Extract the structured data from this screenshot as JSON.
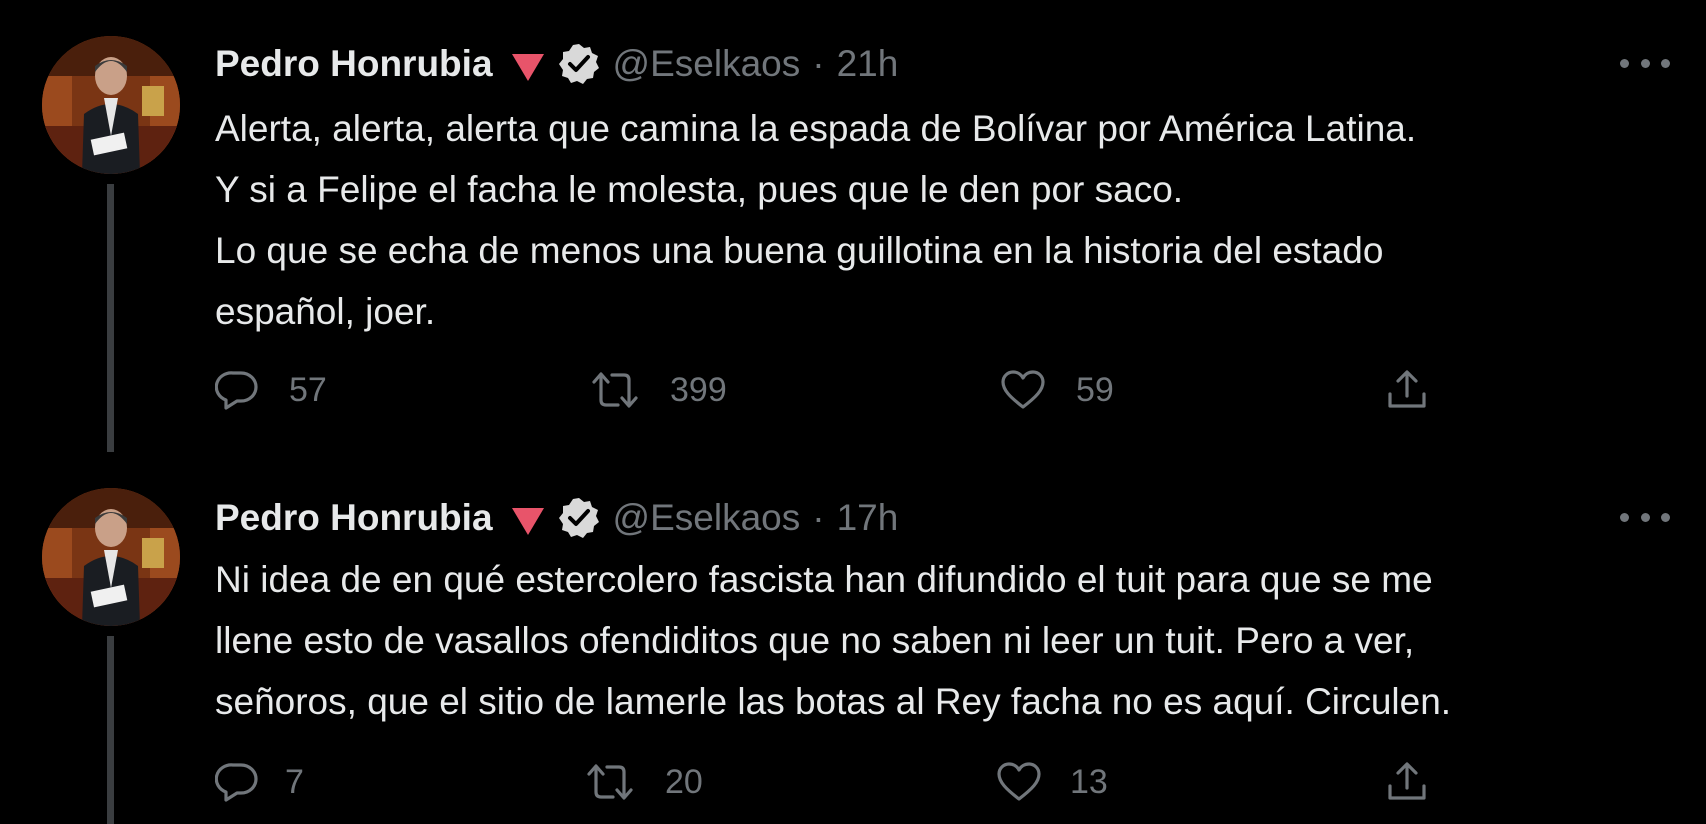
{
  "tweets": [
    {
      "author": {
        "display_name": "Pedro Honrubia",
        "flag_emoji": "red-triangle-down-icon",
        "verified": true,
        "handle": "@Eselkaos"
      },
      "separator": "·",
      "time": "21h",
      "lines": [
        "Alerta, alerta, alerta que camina la espada de Bolívar por América Latina.",
        "Y si a Felipe el facha le molesta, pues que le den por saco.",
        "Lo que se echa de menos una buena guillotina en la historia del estado",
        "español, joer."
      ],
      "stats": {
        "replies": "57",
        "retweets": "399",
        "likes": "59"
      }
    },
    {
      "author": {
        "display_name": "Pedro Honrubia",
        "flag_emoji": "red-triangle-down-icon",
        "verified": true,
        "handle": "@Eselkaos"
      },
      "separator": "·",
      "time": "17h",
      "lines": [
        "Ni idea de en qué estercolero fascista han difundido el tuit para que se me",
        "llene esto de vasallos ofendiditos que no saben ni leer un tuit. Pero a ver,",
        "señoros, que el sitio de lamerle las botas al Rey facha no es aquí. Circulen."
      ],
      "stats": {
        "replies": "7",
        "retweets": "20",
        "likes": "13"
      }
    }
  ],
  "colors": {
    "background": "#000000",
    "text_primary": "#e7e9ea",
    "text_secondary": "#71767b",
    "thread_line": "#3a3d40",
    "triangle_emoji": "#e8546a",
    "verified_badge": "#d9d9d9"
  },
  "icons": {
    "reply": "reply-icon",
    "retweet": "retweet-icon",
    "like": "like-icon",
    "share": "share-icon",
    "more": "more-options-icon",
    "verified": "verified-badge-icon"
  }
}
